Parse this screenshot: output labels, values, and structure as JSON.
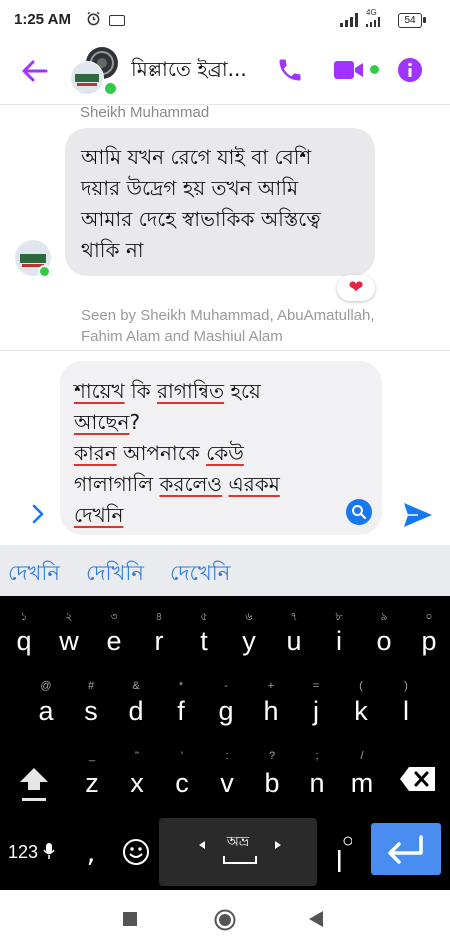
{
  "status_bar": {
    "time": "1:25 AM",
    "network": "4G",
    "battery": "54"
  },
  "header": {
    "contact_name": "মিল্লাতে ইব্রা...",
    "accent_color": "#a033ff"
  },
  "conversation": {
    "sender_name": "Sheikh Muhammad",
    "message_lines": [
      "আমি যখন রেগে যাই বা বেশি",
      "দয়ার উদ্রেগ হয় তখন আমি",
      "আমার দেহে স্বাভাকিক অস্তিত্বে",
      "থাকি না"
    ],
    "reaction": "❤",
    "seen_line1": "Seen by Sheikh Muhammad, AbuAmatullah,",
    "seen_line2": "Fahim Alam and Mashiul Alam"
  },
  "composer": {
    "draft": {
      "l1a": "শায়েখ",
      "l1b": " কি ",
      "l1c": "রাগান্বিত",
      "l1d": " হয়ে",
      "l2a": "আছেন",
      "l2b": "?",
      "l3a": "কারন",
      "l3b": " আপনাকে ",
      "l3c": "কেউ",
      "l4a": "গালাগালি ",
      "l4b": "করলেও",
      "l4c": " ",
      "l4d": "এরকম",
      "l5a": "দেখনি"
    }
  },
  "suggestions": [
    "দেখনি",
    "দেখিনি",
    "দেখেনি"
  ],
  "keyboard": {
    "row1": [
      {
        "hint": "১",
        "ch": "q"
      },
      {
        "hint": "২",
        "ch": "w"
      },
      {
        "hint": "৩",
        "ch": "e"
      },
      {
        "hint": "৪",
        "ch": "r"
      },
      {
        "hint": "৫",
        "ch": "t"
      },
      {
        "hint": "৬",
        "ch": "y"
      },
      {
        "hint": "৭",
        "ch": "u"
      },
      {
        "hint": "৮",
        "ch": "i"
      },
      {
        "hint": "৯",
        "ch": "o"
      },
      {
        "hint": "০",
        "ch": "p"
      }
    ],
    "row2": [
      {
        "hint": "@",
        "ch": "a"
      },
      {
        "hint": "#",
        "ch": "s"
      },
      {
        "hint": "&",
        "ch": "d"
      },
      {
        "hint": "*",
        "ch": "f"
      },
      {
        "hint": "-",
        "ch": "g"
      },
      {
        "hint": "+",
        "ch": "h"
      },
      {
        "hint": "=",
        "ch": "j"
      },
      {
        "hint": "(",
        "ch": "k"
      },
      {
        "hint": ")",
        "ch": "l"
      }
    ],
    "row3": [
      {
        "hint": "_",
        "ch": "z"
      },
      {
        "hint": "\"",
        "ch": "x"
      },
      {
        "hint": "'",
        "ch": "c"
      },
      {
        "hint": ":",
        "ch": "v"
      },
      {
        "hint": "?",
        "ch": "b"
      },
      {
        "hint": ";",
        "ch": "n"
      },
      {
        "hint": "/",
        "ch": "m"
      }
    ],
    "num_key": "123",
    "comma": ",",
    "space_label": "অভ্র"
  }
}
